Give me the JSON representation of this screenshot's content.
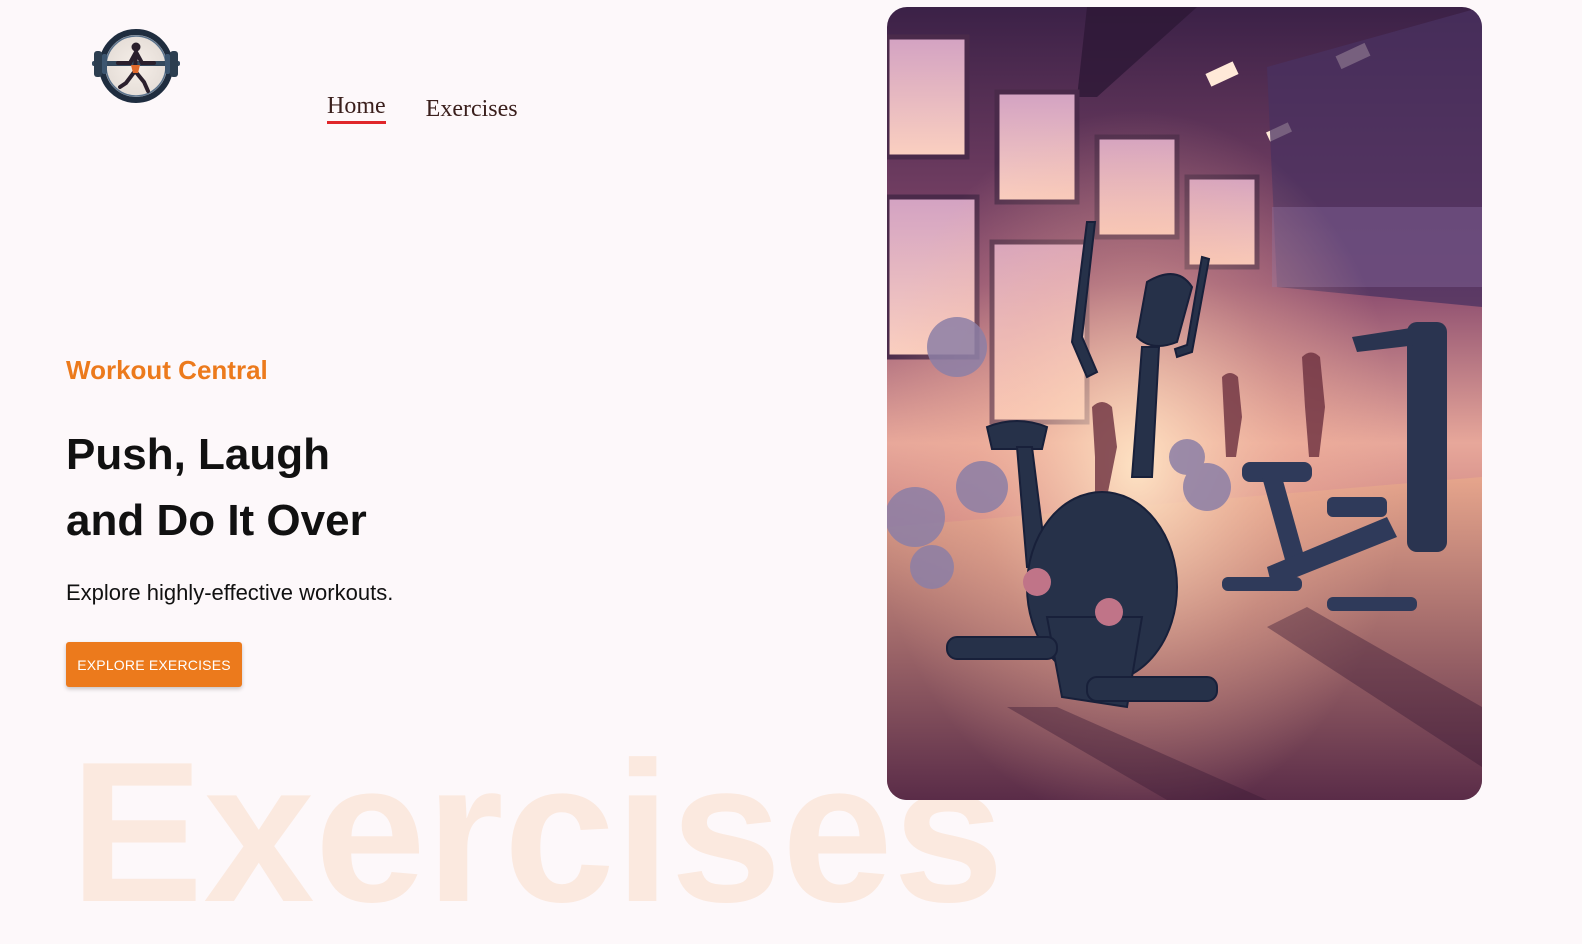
{
  "header": {
    "logo_name": "barbell-woman-logo",
    "nav": [
      {
        "label": "Home",
        "active": true
      },
      {
        "label": "Exercises",
        "active": false
      }
    ]
  },
  "hero": {
    "eyebrow": "Workout Central",
    "headline_line1": "Push, Laugh",
    "headline_line2": "and Do It Over",
    "subhead": "Explore highly-effective workouts.",
    "cta_label": "EXPLORE EXERCISES",
    "background_word": "Exercises",
    "image_name": "gym-exercise-bikes-illustration"
  },
  "colors": {
    "accent": "#ec7a1c",
    "nav_active_underline": "#e0262a",
    "page_background": "#fdf8fa",
    "watermark_text": "#fbe9df"
  }
}
